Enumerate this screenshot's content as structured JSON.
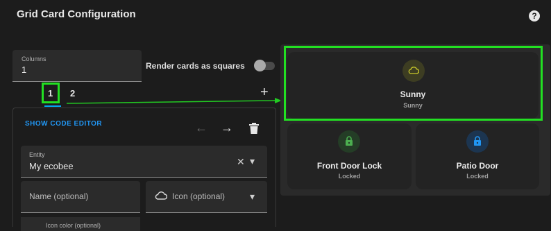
{
  "header": {
    "title": "Grid Card Configuration",
    "help_icon": "help-circle-icon",
    "help_glyph": "?"
  },
  "columns": {
    "label": "Columns",
    "value": "1"
  },
  "render_squares": {
    "label": "Render cards as squares",
    "checked": false
  },
  "tabs": [
    {
      "label": "1",
      "selected": true
    },
    {
      "label": "2",
      "selected": false
    }
  ],
  "add_tab_glyph": "+",
  "editor": {
    "show_code_label": "SHOW CODE EDITOR",
    "move_back_glyph": "←",
    "move_forward_glyph": "→",
    "entity": {
      "label": "Entity",
      "value": "My ecobee",
      "clear_glyph": "✕",
      "dropdown_glyph": "▾"
    },
    "name": {
      "placeholder": "Name (optional)"
    },
    "icon": {
      "placeholder": "Icon (optional)",
      "dropdown_glyph": "▾"
    },
    "icon_color_label": "Icon color (optional)"
  },
  "preview": {
    "cards": [
      {
        "title": "Sunny",
        "subtitle": "Sunny",
        "icon": "weather-cloudy-icon",
        "accent": "#c8c82a",
        "circle_bg": "#3d3d22"
      },
      {
        "title": "Front Door Lock",
        "subtitle": "Locked",
        "icon": "lock-icon",
        "accent": "#4caf50",
        "circle_bg": "#243d26"
      },
      {
        "title": "Patio Door",
        "subtitle": "Locked",
        "icon": "lock-icon",
        "accent": "#2196f3",
        "circle_bg": "#1c3550"
      }
    ]
  },
  "colors": {
    "highlight": "#22e022",
    "accent_blue": "#03a9f4",
    "background": "#1c1c1c"
  }
}
